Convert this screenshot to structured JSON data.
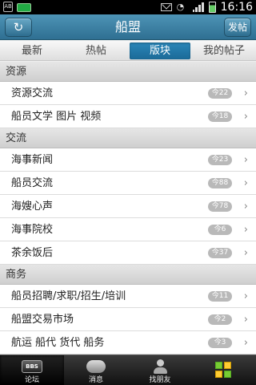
{
  "status_bar": {
    "time": "16:16",
    "usb_label": "AB"
  },
  "header": {
    "title": "船盟",
    "post_label": "发帖",
    "refresh_icon": "refresh-icon"
  },
  "tabs": [
    {
      "label": "最新",
      "active": false
    },
    {
      "label": "热帖",
      "active": false
    },
    {
      "label": "版块",
      "active": true
    },
    {
      "label": "我的帖子",
      "active": false
    }
  ],
  "sections": [
    {
      "title": "资源",
      "items": [
        {
          "label": "资源交流",
          "badge": "今22"
        },
        {
          "label": "船员文学 图片 视频",
          "badge": "今18"
        }
      ]
    },
    {
      "title": "交流",
      "items": [
        {
          "label": "海事新闻",
          "badge": "今23"
        },
        {
          "label": "船员交流",
          "badge": "今88"
        },
        {
          "label": "海嫂心声",
          "badge": "今78"
        },
        {
          "label": "海事院校",
          "badge": "今6"
        },
        {
          "label": "茶余饭后",
          "badge": "今37"
        }
      ]
    },
    {
      "title": "商务",
      "items": [
        {
          "label": "船员招聘/求职/招生/培训",
          "badge": "今11"
        },
        {
          "label": "船盟交易市场",
          "badge": "今2"
        },
        {
          "label": "航运 船代 货代 船务",
          "badge": "今3"
        }
      ]
    }
  ],
  "bottom_nav": [
    {
      "label": "论坛",
      "icon": "bbs-icon",
      "icon_text": "BBS",
      "active": true
    },
    {
      "label": "消息",
      "icon": "message-icon",
      "active": false
    },
    {
      "label": "找朋友",
      "icon": "find-friend-icon",
      "active": false
    },
    {
      "label": "",
      "icon": "more-apps-icon",
      "active": false
    }
  ]
}
